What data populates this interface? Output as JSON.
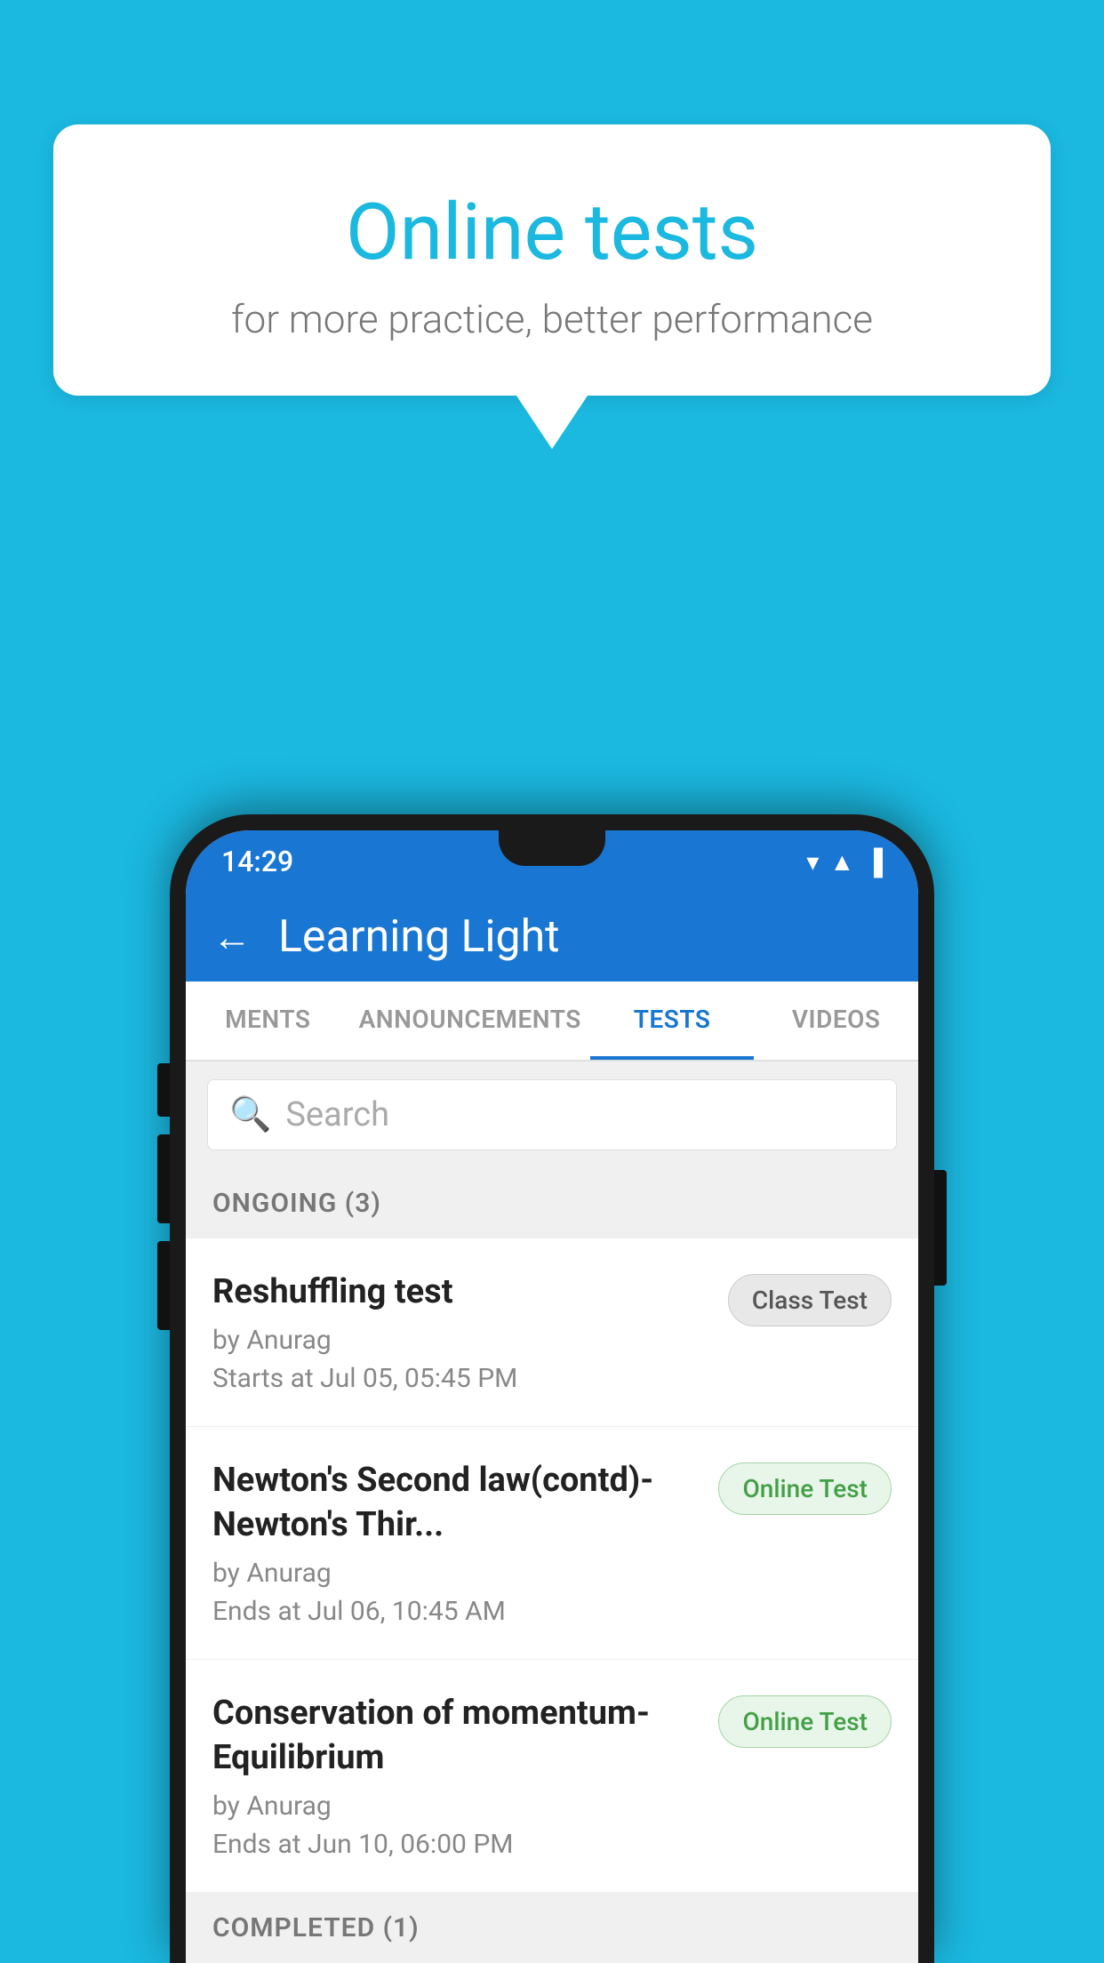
{
  "background": {
    "color": "#1BB8E0"
  },
  "speech_bubble": {
    "title": "Online tests",
    "subtitle": "for more practice, better performance"
  },
  "phone": {
    "status_bar": {
      "time": "14:29",
      "icons": [
        "wifi",
        "signal",
        "battery"
      ]
    },
    "app_bar": {
      "title": "Learning Light",
      "back_label": "←"
    },
    "tabs": [
      {
        "label": "MENTS",
        "active": false
      },
      {
        "label": "ANNOUNCEMENTS",
        "active": false
      },
      {
        "label": "TESTS",
        "active": true
      },
      {
        "label": "VIDEOS",
        "active": false
      }
    ],
    "search": {
      "placeholder": "Search"
    },
    "sections": [
      {
        "title": "ONGOING (3)",
        "items": [
          {
            "name": "Reshuffling test",
            "by": "by Anurag",
            "time": "Starts at  Jul 05, 05:45 PM",
            "badge": "Class Test",
            "badge_type": "class"
          },
          {
            "name": "Newton's Second law(contd)-Newton's Thir...",
            "by": "by Anurag",
            "time": "Ends at  Jul 06, 10:45 AM",
            "badge": "Online Test",
            "badge_type": "online"
          },
          {
            "name": "Conservation of momentum-Equilibrium",
            "by": "by Anurag",
            "time": "Ends at  Jun 10, 06:00 PM",
            "badge": "Online Test",
            "badge_type": "online"
          }
        ]
      }
    ],
    "completed_section": {
      "title": "COMPLETED (1)"
    }
  }
}
